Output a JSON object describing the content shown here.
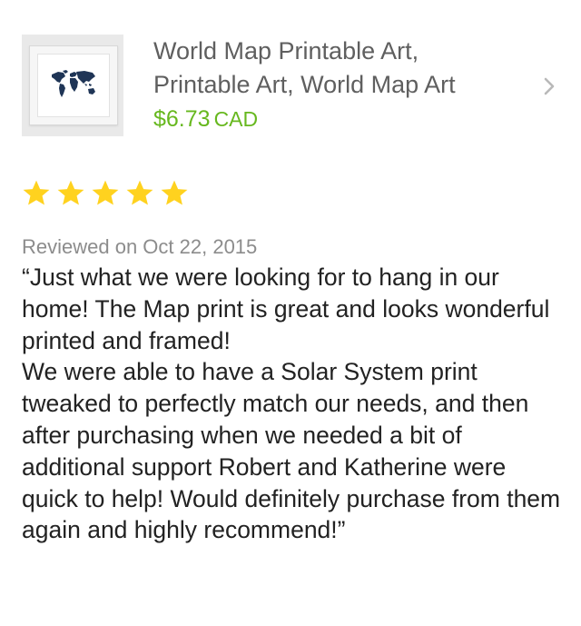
{
  "product": {
    "image_icon": "world-map-print-thumbnail",
    "title_line1": "World Map Printable Art,",
    "title_line2": "Printable Art, World Map Art",
    "price": "$6.73",
    "currency": "CAD",
    "price_color": "#67b81f",
    "chevron_icon": "chevron-right-icon"
  },
  "review": {
    "rating": 5,
    "rating_max": 5,
    "star_color": "#ffd21f",
    "date_label": "Reviewed on Oct 22, 2015",
    "paragraph1": "“Just what we were looking for to hang in our home! The Map print is great and looks wonderful printed and framed!",
    "paragraph2": "We were able to have a Solar System print tweaked to perfectly match our needs, and then after purchasing when we needed a bit of additional support Robert and Katherine were quick to help! Would definitely purchase from them again and highly recommend!”"
  }
}
